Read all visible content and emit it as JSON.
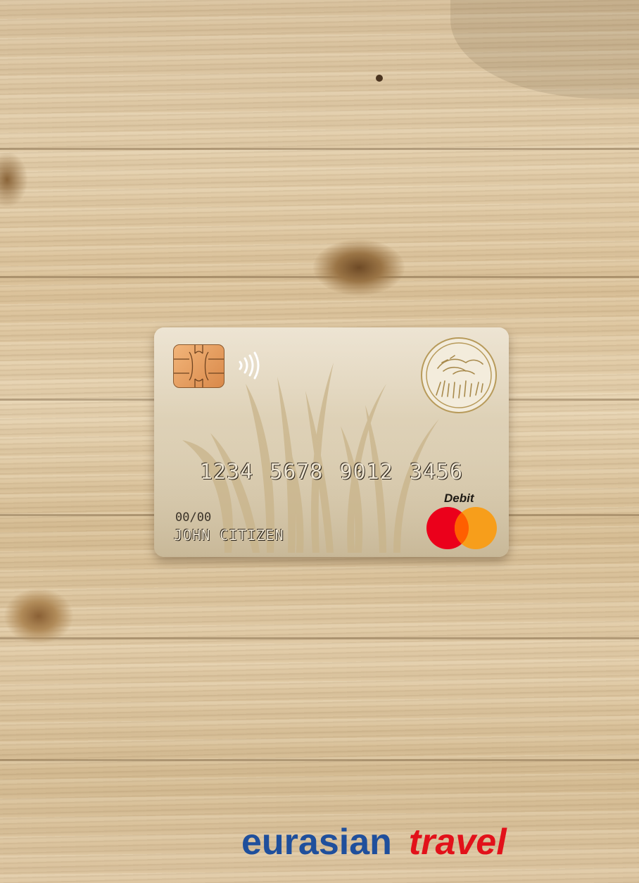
{
  "card": {
    "number": "1234 5678 9012 3456",
    "expiry": "00/00",
    "holder": "JOHN CITIZEN",
    "type_label": "Debit",
    "network": "mastercard",
    "chip_icon": "emv-chip-icon",
    "contactless_icon": "contactless-icon",
    "emblem_icon": "bird-seal-icon"
  },
  "watermark": {
    "word1": "eurasian",
    "word2": "travel"
  },
  "colors": {
    "brand_blue": "#1f4f9c",
    "brand_red": "#e2111a",
    "mastercard_red": "#eb001b",
    "mastercard_orange": "#f79e1b",
    "card_gold": "#ddd0b5"
  }
}
